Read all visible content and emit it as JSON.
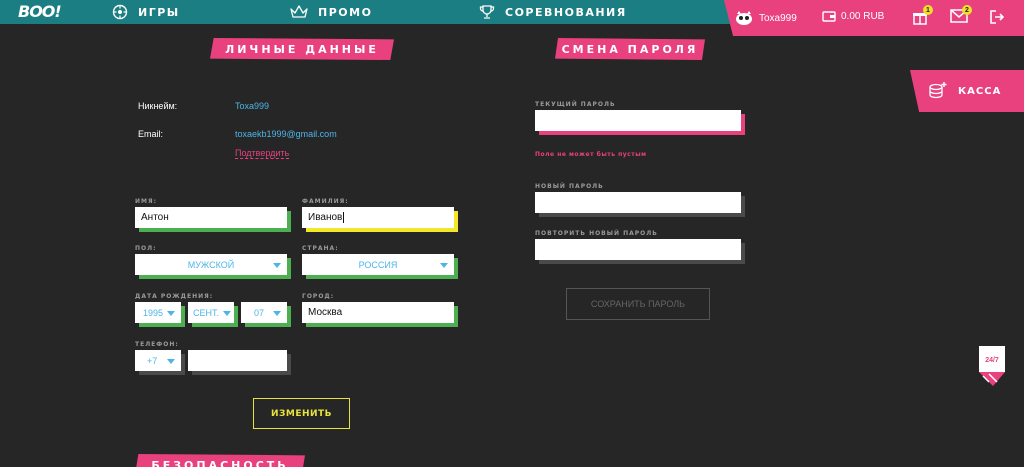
{
  "brand": {
    "logo": "BOO!"
  },
  "nav": [
    {
      "label": "ИГРЫ",
      "icon": "games-icon"
    },
    {
      "label": "ПРОМО",
      "icon": "crown-icon"
    },
    {
      "label": "СОРЕВНОВАНИЯ",
      "icon": "trophy-icon"
    }
  ],
  "user": {
    "username": "Toxa999",
    "balance": "0.00 RUB",
    "gifts_count": "1",
    "messages_count": "2"
  },
  "cashier": {
    "label": "КАССА"
  },
  "personal": {
    "title": "ЛИЧНЫЕ ДАННЫЕ",
    "nickname_label": "Никнейм:",
    "nickname_value": "Toxa999",
    "email_label": "Email:",
    "email_value": "toxaekb1999@gmail.com",
    "confirm_link": "Подтвердить",
    "first_name_label": "ИМЯ:",
    "first_name_value": "Антон",
    "last_name_label": "ФАМИЛИЯ:",
    "last_name_value": "Иванов",
    "gender_label": "ПОЛ:",
    "gender_value": "МУЖСКОЙ",
    "country_label": "СТРАНА:",
    "country_value": "РОССИЯ",
    "birthdate_label": "ДАТА РОЖДЕНИЯ:",
    "birth_year": "1995",
    "birth_month": "СЕНТ.",
    "birth_day": "07",
    "city_label": "ГОРОД:",
    "city_value": "Москва",
    "phone_label": "ТЕЛЕФОН:",
    "phone_code": "+7",
    "phone_value": "",
    "submit_label": "ИЗМЕНИТЬ"
  },
  "password": {
    "title": "СМЕНА ПАРОЛЯ",
    "current_label": "ТЕКУЩИЙ ПАРОЛЬ",
    "error_text": "Поле не может быть пустым",
    "new_label": "НОВЫЙ ПАРОЛЬ",
    "repeat_label": "ПОВТОРИТЬ НОВЫЙ ПАРОЛЬ",
    "save_label": "СОХРАНИТЬ ПАРОЛЬ"
  },
  "security": {
    "title": "БЕЗОПАСНОСТЬ"
  },
  "support": {
    "label": "24/7"
  },
  "colors": {
    "accent_pink": "#e8417e",
    "topbar_teal": "#1b7e82",
    "field_green": "#4caf50",
    "field_yellow": "#f2e829",
    "link_blue": "#4db5e8",
    "background": "#262626"
  }
}
